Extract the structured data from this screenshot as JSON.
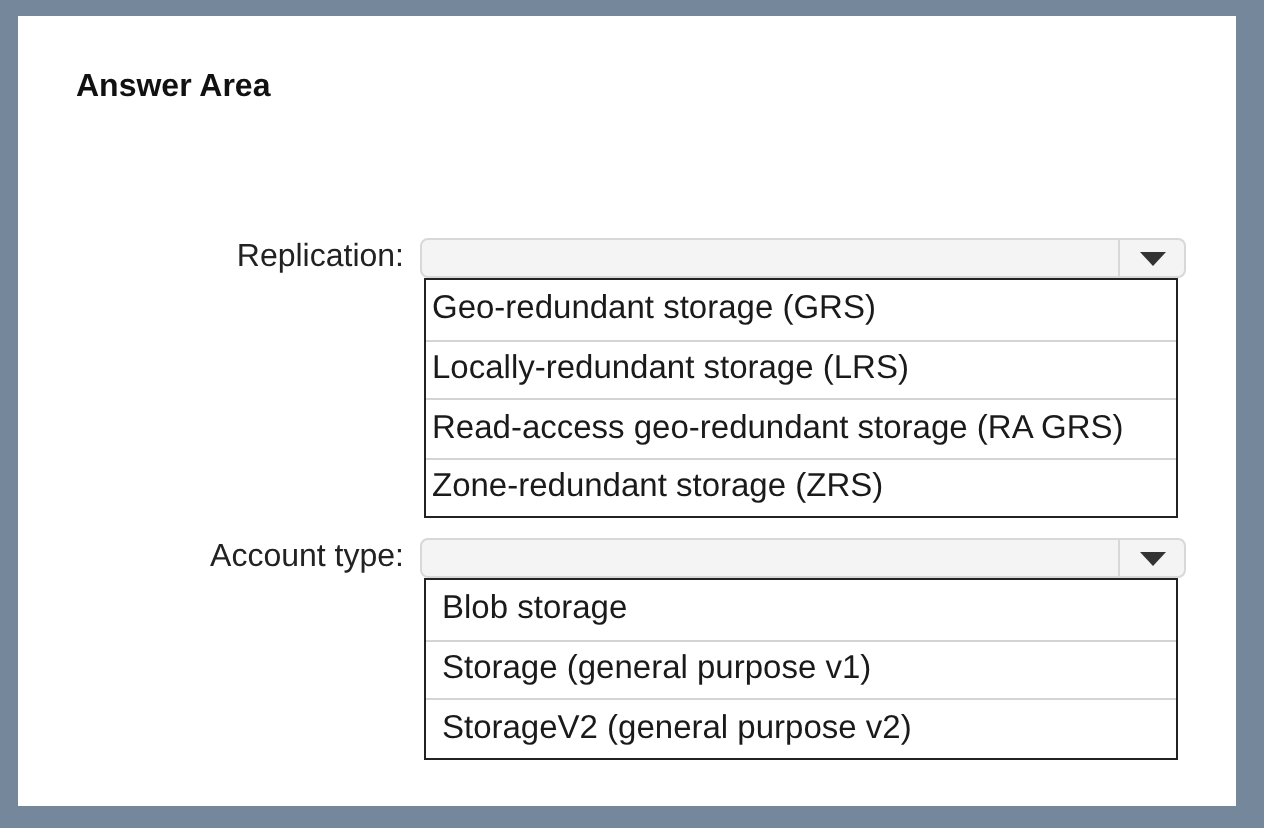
{
  "title": "Answer Area",
  "questions": [
    {
      "label": "Replication:",
      "options": [
        "Geo-redundant storage (GRS)",
        "Locally-redundant storage (LRS)",
        "Read-access geo-redundant storage (RA GRS)",
        "Zone-redundant storage (ZRS)"
      ]
    },
    {
      "label": "Account type:",
      "options": [
        "Blob storage",
        "Storage (general purpose v1)",
        "StorageV2 (general purpose v2)"
      ]
    }
  ]
}
